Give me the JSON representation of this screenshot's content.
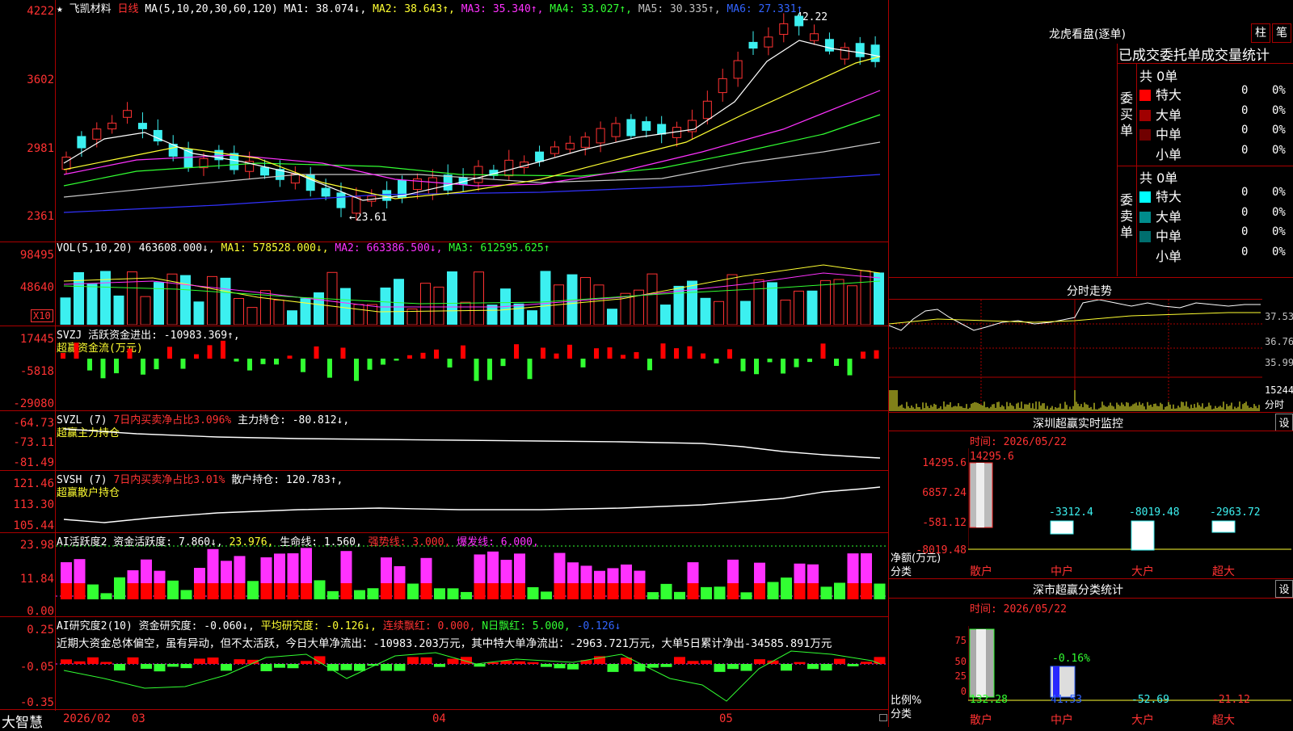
{
  "stock": {
    "name": "★ 飞凯材料",
    "period": "日线",
    "ma_label": "MA(5,10,20,30,60,120)",
    "ma1": "MA1: 38.074↓,",
    "ma2": "MA2: 38.643↑,",
    "ma3": "MA3: 35.340↑,",
    "ma4": "MA4: 33.027↑,",
    "ma5": "MA5: 30.335↑,",
    "ma6": "MA6: 27.331↑",
    "high_label": "42.22",
    "low_label": "←23.61",
    "axis": [
      "4222",
      "3602",
      "2981",
      "2361"
    ]
  },
  "vol": {
    "label": "VOL(5,10,20)",
    "value": "463608.000↓,",
    "ma1": "MA1: 578528.000↓,",
    "ma2": "MA2: 663386.500↓,",
    "ma3": "MA3: 612595.625↑",
    "axis": [
      "98495",
      "48640"
    ],
    "unit": "X10"
  },
  "svzj": {
    "label": "SVZJ  活跃资金进出: -10983.369↑,",
    "sub": "超赢资金流(万元)",
    "axis": [
      "17445",
      "-5818",
      "-29080"
    ]
  },
  "svzl": {
    "label": "SVZL (7)",
    "pct": "7日内买卖净占比3.096%",
    "val": "主力持仓: -80.812↓,",
    "sub": "超赢主力持仓",
    "axis": [
      "-64.73",
      "-73.11",
      "-81.49"
    ]
  },
  "svsh": {
    "label": "SVSH (7)",
    "pct": "7日内买卖净占比3.01%",
    "val": "散户持仓: 120.783↑,",
    "sub": "超赢散户持仓",
    "axis": [
      "121.46",
      "113.30",
      "105.44"
    ]
  },
  "ai2": {
    "label": "AI活跃度2 资金活跃度: 7.860↓,",
    "v2": "23.976,",
    "v3": "生命线: 1.560,",
    "v4": "强势线: 3.000,",
    "v5": "爆发线: 6.000,",
    "axis": [
      "23.98",
      "11.84",
      "0.00"
    ]
  },
  "aiyj": {
    "label": "AI研究度2(10) 资金研究度: -0.060↓,",
    "v2": "平均研究度: -0.126↓,",
    "v3": "连续飘红: 0.000,",
    "v4": "N日飘红: 5.000,",
    "v5": "-0.126↓",
    "comment": "近期大资金总体偏空，虽有异动，但不太活跃，今日大单净流出：-10983.203万元，其中特大单净流出：-2963.721万元，大单5日累计净出-34585.891万元",
    "axis": [
      "0.25",
      "-0.05",
      "-0.35"
    ]
  },
  "bottom": {
    "brand": "大智慧",
    "dates": [
      "2026/02",
      "03",
      "04",
      "05"
    ]
  },
  "longhu": {
    "title": "龙虎看盘(逐单)",
    "tab1": "柱",
    "tab2": "笔",
    "header": "已成交委托单成交量统计",
    "buy_label": "委买单",
    "sell_label": "委卖单",
    "buy_total": "共 0单",
    "sell_total": "共 0单",
    "buy_rows": [
      {
        "name": "特大",
        "count": "0",
        "pct": "0%",
        "color": "#ff0000"
      },
      {
        "name": "大单",
        "count": "0",
        "pct": "0%",
        "color": "#a00000"
      },
      {
        "name": "中单",
        "count": "0",
        "pct": "0%",
        "color": "#700000"
      },
      {
        "name": "小单",
        "count": "0",
        "pct": "0%",
        "color": "#000000"
      }
    ],
    "sell_rows": [
      {
        "name": "特大",
        "count": "0",
        "pct": "0%",
        "color": "#00ffff"
      },
      {
        "name": "大单",
        "count": "0",
        "pct": "0%",
        "color": "#008c8c"
      },
      {
        "name": "中单",
        "count": "0",
        "pct": "0%",
        "color": "#006e6e"
      },
      {
        "name": "小单",
        "count": "0",
        "pct": "0%",
        "color": "#000000"
      }
    ]
  },
  "fenshi": {
    "title": "分时走势",
    "axis": [
      "37.53",
      "36.76",
      "35.99"
    ],
    "vol_label": "15244",
    "vol_unit": "分时"
  },
  "sz_monitor": {
    "title": "深圳超赢实时监控",
    "set": "设",
    "time": "时间: 2026/05/22",
    "axis": [
      "14295.6",
      "6857.24",
      "-581.12",
      "-8019.48"
    ],
    "ylabel1": "净额(万元)",
    "ylabel2": "分类",
    "values": [
      "14295.6",
      "-3312.4",
      "-8019.48",
      "-2963.72"
    ],
    "cats": [
      "散户",
      "中户",
      "大户",
      "超大"
    ]
  },
  "sz_class": {
    "title": "深市超赢分类统计",
    "set": "设",
    "time": "时间: 2026/05/22",
    "axis": [
      "75",
      "50",
      "25",
      "0"
    ],
    "ylabel1": "比例%",
    "ylabel2": "分类",
    "note": "-0.16%",
    "values": [
      "132.28",
      "41.53",
      "-52.69",
      "-21.12"
    ],
    "cats": [
      "散户",
      "中户",
      "大户",
      "超大"
    ]
  }
}
